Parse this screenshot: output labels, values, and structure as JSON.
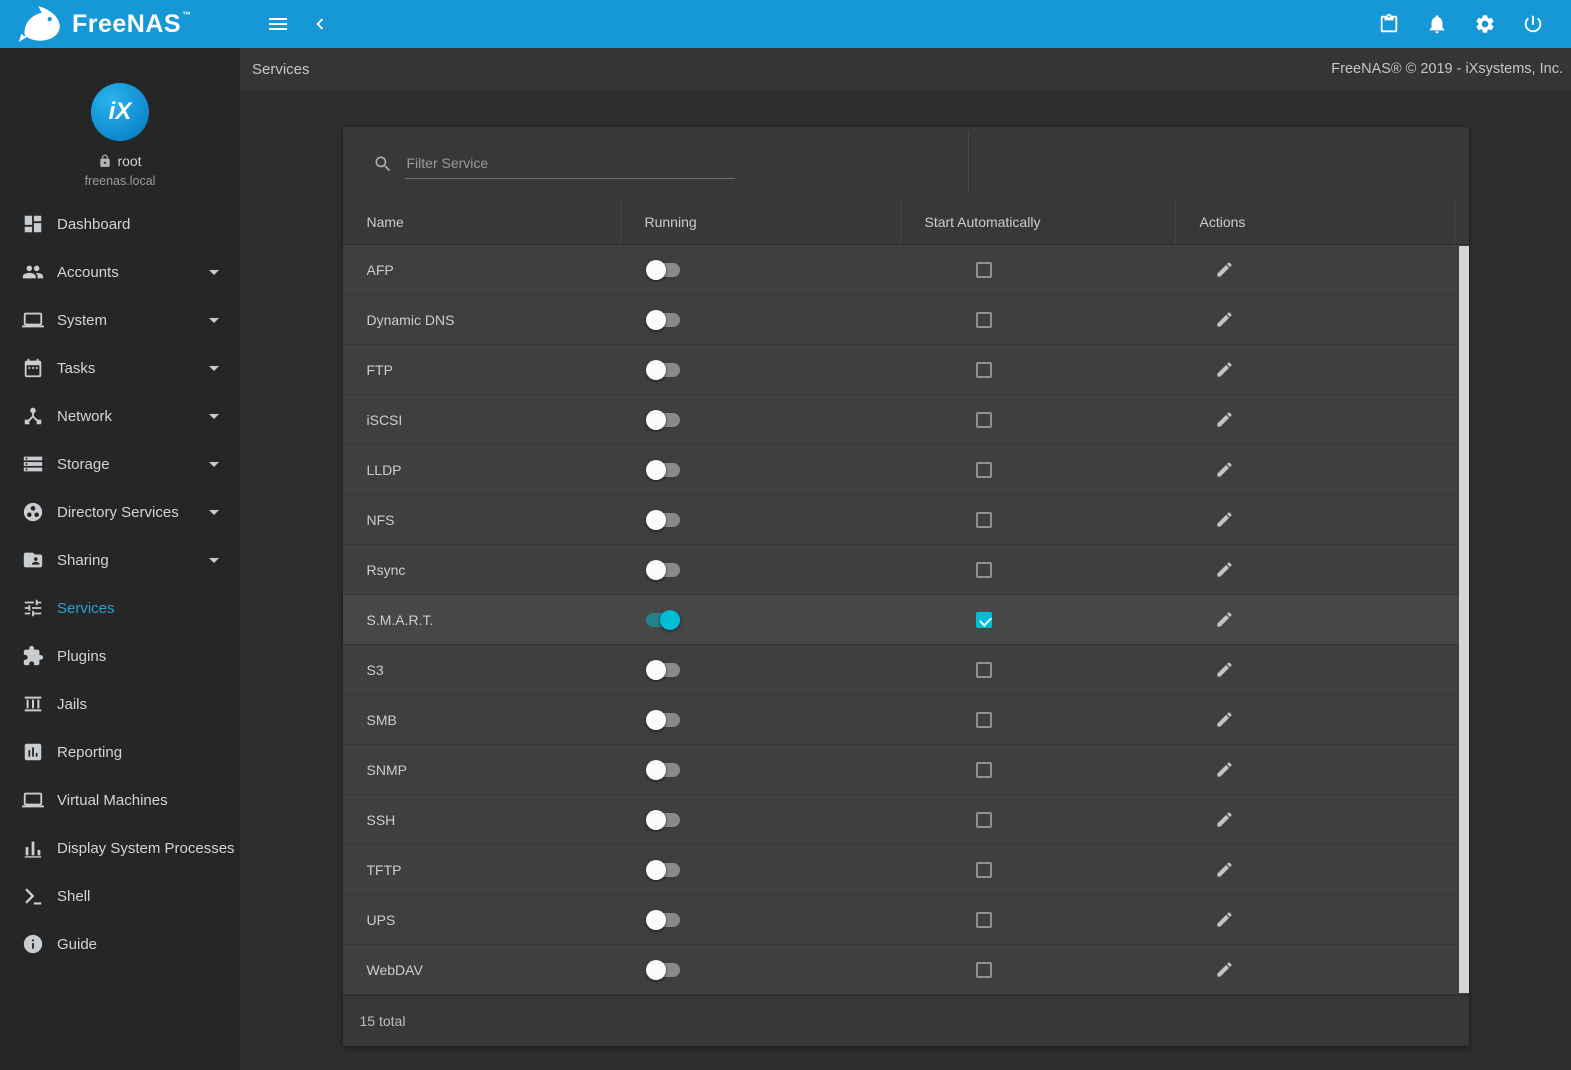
{
  "colors": {
    "topbar": "#1697d6",
    "accent": "#00bcd4",
    "active-link": "#2b9fd9"
  },
  "topbar": {
    "logo_text": "FreeNAS",
    "logo_tm": "™",
    "left_icons": [
      "menu-icon",
      "chevron-left-icon"
    ],
    "right_icons": [
      "tasks-clipboard-icon",
      "notifications-icon",
      "settings-icon",
      "power-icon"
    ]
  },
  "toolbar": {
    "title": "Services",
    "copyright": "FreeNAS® © 2019 - iXsystems, Inc."
  },
  "sidebar": {
    "user": {
      "avatar_text": "iX",
      "name": "root",
      "host": "freenas.local"
    },
    "items": [
      {
        "label": "Dashboard",
        "icon": "dashboard",
        "expandable": false,
        "active": false
      },
      {
        "label": "Accounts",
        "icon": "people",
        "expandable": true,
        "active": false
      },
      {
        "label": "System",
        "icon": "computer",
        "expandable": true,
        "active": false
      },
      {
        "label": "Tasks",
        "icon": "calendar",
        "expandable": true,
        "active": false
      },
      {
        "label": "Network",
        "icon": "hub",
        "expandable": true,
        "active": false
      },
      {
        "label": "Storage",
        "icon": "storage",
        "expandable": true,
        "active": false
      },
      {
        "label": "Directory Services",
        "icon": "groupwork",
        "expandable": true,
        "active": false
      },
      {
        "label": "Sharing",
        "icon": "foldershared",
        "expandable": true,
        "active": false
      },
      {
        "label": "Services",
        "icon": "tune",
        "expandable": false,
        "active": true
      },
      {
        "label": "Plugins",
        "icon": "extension",
        "expandable": false,
        "active": false
      },
      {
        "label": "Jails",
        "icon": "jails",
        "expandable": false,
        "active": false
      },
      {
        "label": "Reporting",
        "icon": "chart",
        "expandable": false,
        "active": false
      },
      {
        "label": "Virtual Machines",
        "icon": "computer",
        "expandable": false,
        "active": false
      },
      {
        "label": "Display System Processes",
        "icon": "processes",
        "expandable": false,
        "active": false
      },
      {
        "label": "Shell",
        "icon": "shell",
        "expandable": false,
        "active": false
      },
      {
        "label": "Guide",
        "icon": "info",
        "expandable": false,
        "active": false
      }
    ]
  },
  "main": {
    "filter_placeholder": "Filter Service",
    "table": {
      "columns": [
        "Name",
        "Running",
        "Start Automatically",
        "Actions"
      ],
      "row_action_icon": "edit-icon",
      "rows": [
        {
          "name": "AFP",
          "running": false,
          "start_automatically": false
        },
        {
          "name": "Dynamic DNS",
          "running": false,
          "start_automatically": false
        },
        {
          "name": "FTP",
          "running": false,
          "start_automatically": false
        },
        {
          "name": "iSCSI",
          "running": false,
          "start_automatically": false
        },
        {
          "name": "LLDP",
          "running": false,
          "start_automatically": false
        },
        {
          "name": "NFS",
          "running": false,
          "start_automatically": false
        },
        {
          "name": "Rsync",
          "running": false,
          "start_automatically": false
        },
        {
          "name": "S.M.A.R.T.",
          "running": true,
          "start_automatically": true
        },
        {
          "name": "S3",
          "running": false,
          "start_automatically": false
        },
        {
          "name": "SMB",
          "running": false,
          "start_automatically": false
        },
        {
          "name": "SNMP",
          "running": false,
          "start_automatically": false
        },
        {
          "name": "SSH",
          "running": false,
          "start_automatically": false
        },
        {
          "name": "TFTP",
          "running": false,
          "start_automatically": false
        },
        {
          "name": "UPS",
          "running": false,
          "start_automatically": false
        },
        {
          "name": "WebDAV",
          "running": false,
          "start_automatically": false
        }
      ],
      "footer": "15 total"
    }
  }
}
